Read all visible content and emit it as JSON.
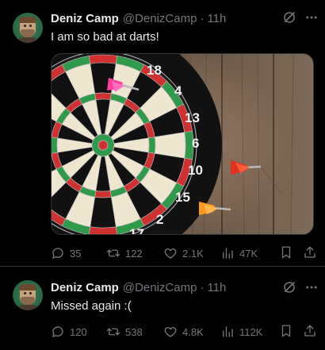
{
  "tweets": [
    {
      "author_name": "Deniz Camp",
      "handle": "@DenizCamp",
      "separator": "·",
      "time": "11h",
      "text": "I am so bad at darts!",
      "board_numbers": [
        "18",
        "4",
        "13",
        "6",
        "10",
        "15",
        "2",
        "17"
      ],
      "actions": {
        "replies": "35",
        "reposts": "122",
        "likes": "2.1K",
        "views": "47K"
      }
    },
    {
      "author_name": "Deniz Camp",
      "handle": "@DenizCamp",
      "separator": "·",
      "time": "11h",
      "text": "Missed again :(",
      "actions": {
        "replies": "120",
        "reposts": "538",
        "likes": "4.8K",
        "views": "112K"
      }
    }
  ],
  "icons": {
    "grok": "grok-icon",
    "more": "more-icon",
    "reply": "reply-icon",
    "repost": "repost-icon",
    "like": "like-icon",
    "views": "views-icon",
    "bookmark": "bookmark-icon",
    "share": "share-icon"
  },
  "colors": {
    "background": "#000000",
    "text": "#e7e9ea",
    "muted": "#71767b",
    "divider": "#2f3336"
  }
}
